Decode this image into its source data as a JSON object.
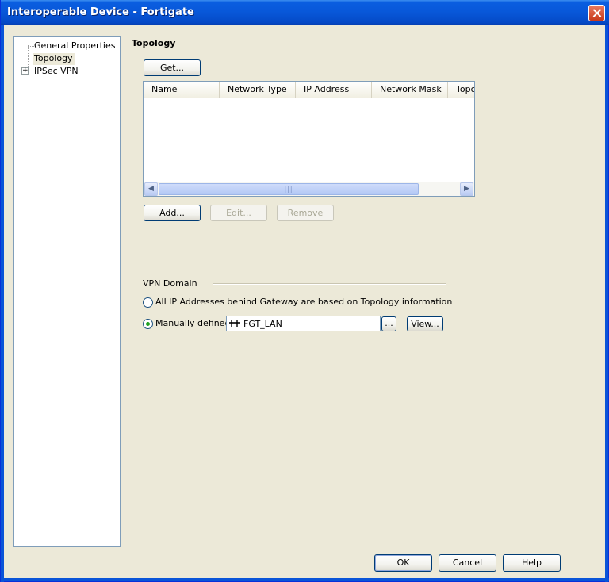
{
  "window": {
    "title": "Interoperable Device - Fortigate"
  },
  "tree": {
    "items": [
      {
        "label": "General Properties"
      },
      {
        "label": "Topology"
      },
      {
        "label": "IPSec VPN"
      }
    ]
  },
  "section": {
    "title": "Topology"
  },
  "buttons": {
    "get": "Get...",
    "add": "Add...",
    "edit": "Edit...",
    "remove": "Remove",
    "browse": "...",
    "view": "View...",
    "ok": "OK",
    "cancel": "Cancel",
    "help": "Help"
  },
  "table": {
    "columns": [
      "Name",
      "Network Type",
      "IP Address",
      "Network Mask",
      "Topo"
    ],
    "rows": []
  },
  "vpn_domain": {
    "label": "VPN Domain",
    "option_all": "All IP Addresses behind Gateway are based on Topology information",
    "option_manual": "Manually defined",
    "selected": "manual",
    "manual_value": "FGT_LAN"
  }
}
